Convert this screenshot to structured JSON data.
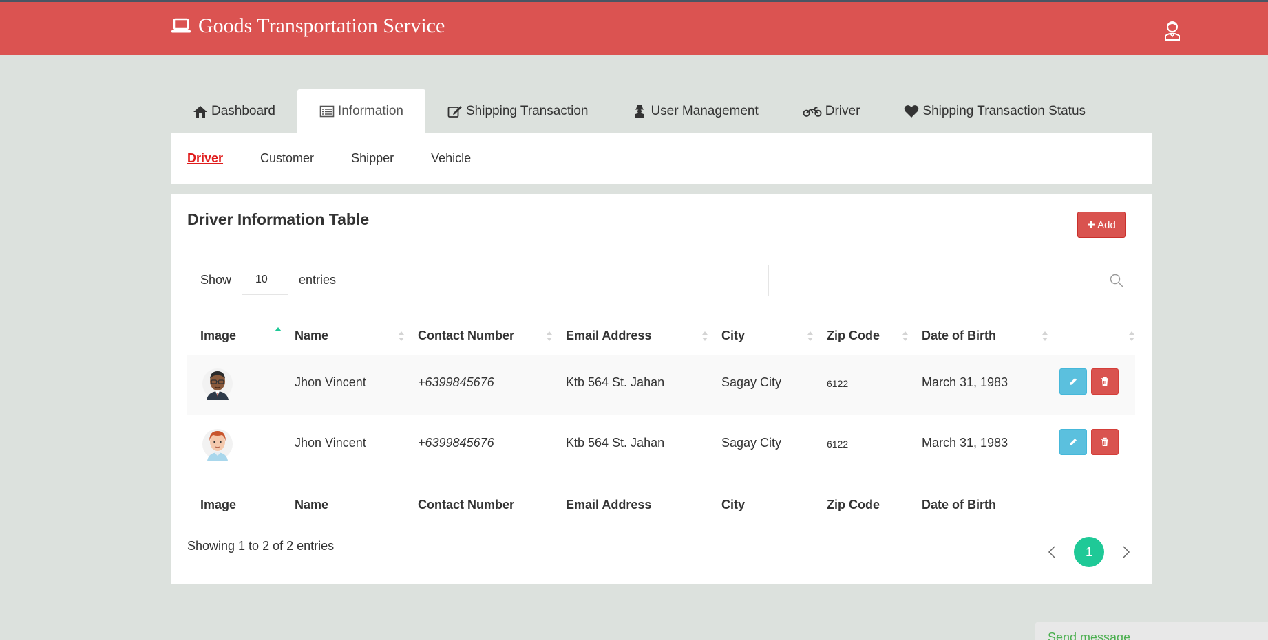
{
  "header": {
    "title": "Goods Transportation Service",
    "brand_icon": "laptop-icon",
    "user_icon": "user-avatar-icon",
    "accent_color": "#db5351"
  },
  "tabs": [
    {
      "label": "Dashboard",
      "icon": "home-icon",
      "active": false
    },
    {
      "label": "Information",
      "icon": "list-icon",
      "active": true
    },
    {
      "label": "Shipping Transaction",
      "icon": "edit-icon",
      "active": false
    },
    {
      "label": "User Management",
      "icon": "user-secret-icon",
      "active": false
    },
    {
      "label": "Driver",
      "icon": "motorcycle-icon",
      "active": false
    },
    {
      "label": "Shipping Transaction Status",
      "icon": "heart-icon",
      "active": false
    }
  ],
  "subnav": [
    {
      "label": "Driver",
      "active": true
    },
    {
      "label": "Customer",
      "active": false
    },
    {
      "label": "Shipper",
      "active": false
    },
    {
      "label": "Vehicle",
      "active": false
    }
  ],
  "panel": {
    "title": "Driver Information Table",
    "add_label": "Add",
    "show_label": "Show",
    "entries_value": "10",
    "entries_label": "entries",
    "search_value": "",
    "info_text": "Showing 1 to 2 of 2 entries",
    "current_page": "1"
  },
  "table": {
    "columns": [
      "Image",
      "Name",
      "Contact Number",
      "Email Address",
      "City",
      "Zip Code",
      "Date of Birth",
      ""
    ],
    "rows": [
      {
        "avatar": "male-driver-glasses-avatar",
        "name": "Jhon Vincent",
        "contact": "+6399845676",
        "email": "Ktb 564 St. Jahan",
        "city": "Sagay City",
        "zip": "6122",
        "dob": "March 31, 1983"
      },
      {
        "avatar": "male-driver-redhair-avatar",
        "name": "Jhon Vincent",
        "contact": "+6399845676",
        "email": "Ktb 564 St. Jahan",
        "city": "Sagay City",
        "zip": "6122",
        "dob": "March 31, 1983"
      }
    ]
  },
  "chat": {
    "label": "Send message"
  }
}
